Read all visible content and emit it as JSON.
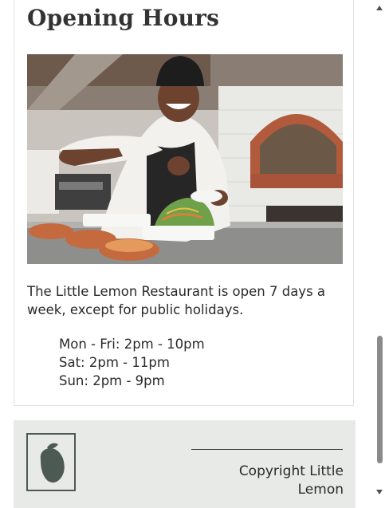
{
  "section": {
    "heading": "Opening Hours",
    "image_description_icon": "chef-photo",
    "intro": "The Little Lemon Restaurant is open 7 days a week, except for public holidays.",
    "hours": [
      "Mon - Fri: 2pm - 10pm",
      "Sat: 2pm - 11pm",
      "Sun: 2pm - 9pm"
    ]
  },
  "footer": {
    "logo_icon": "lemon-logo-icon",
    "copyright": "Copyright Little Lemon"
  },
  "colors": {
    "heading": "#333333",
    "footer_bg": "#e8eae8",
    "logo": "#4d5a53"
  }
}
